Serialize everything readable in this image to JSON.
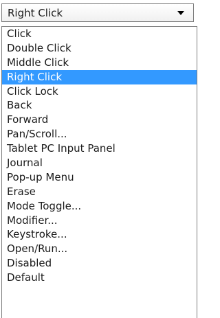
{
  "combo": {
    "selected_label": "Right Click",
    "arrow_icon": "chevron-down-icon"
  },
  "dropdown": {
    "selected_index": 3,
    "highlight_color": "#3399ff",
    "items": [
      "Click",
      "Double Click",
      "Middle Click",
      "Right Click",
      "Click Lock",
      "Back",
      "Forward",
      "Pan/Scroll...",
      "Tablet PC Input Panel",
      "Journal",
      "Pop-up Menu",
      "Erase",
      "Mode Toggle...",
      "Modifier...",
      "Keystroke...",
      "Open/Run...",
      "Disabled",
      "Default"
    ]
  }
}
